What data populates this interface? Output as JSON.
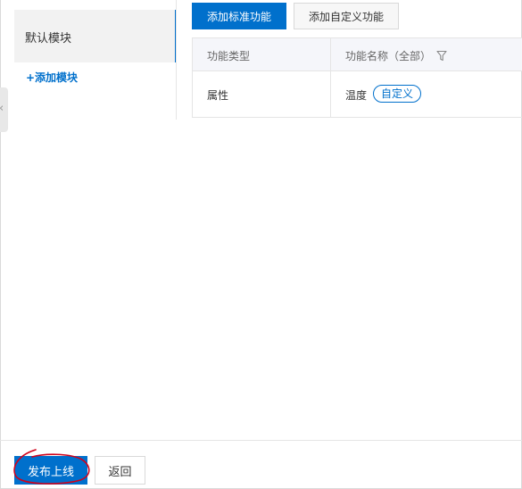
{
  "modules": {
    "items": [
      {
        "label": "默认模块",
        "selected": true
      }
    ],
    "add_label": "+添加模块"
  },
  "toolbar": {
    "add_standard_label": "添加标准功能",
    "add_custom_label": "添加自定义功能"
  },
  "table": {
    "headers": [
      "功能类型",
      "功能名称（全部）"
    ],
    "rows": [
      {
        "type": "属性",
        "name": "温度",
        "tag": "自定义"
      }
    ]
  },
  "footer": {
    "publish_label": "发布上线",
    "back_label": "返回"
  },
  "icons": {
    "filter": "filter-icon",
    "collapse": "chevron-left-icon"
  },
  "colors": {
    "accent": "#0070cc",
    "annotation": "#d0021b"
  }
}
